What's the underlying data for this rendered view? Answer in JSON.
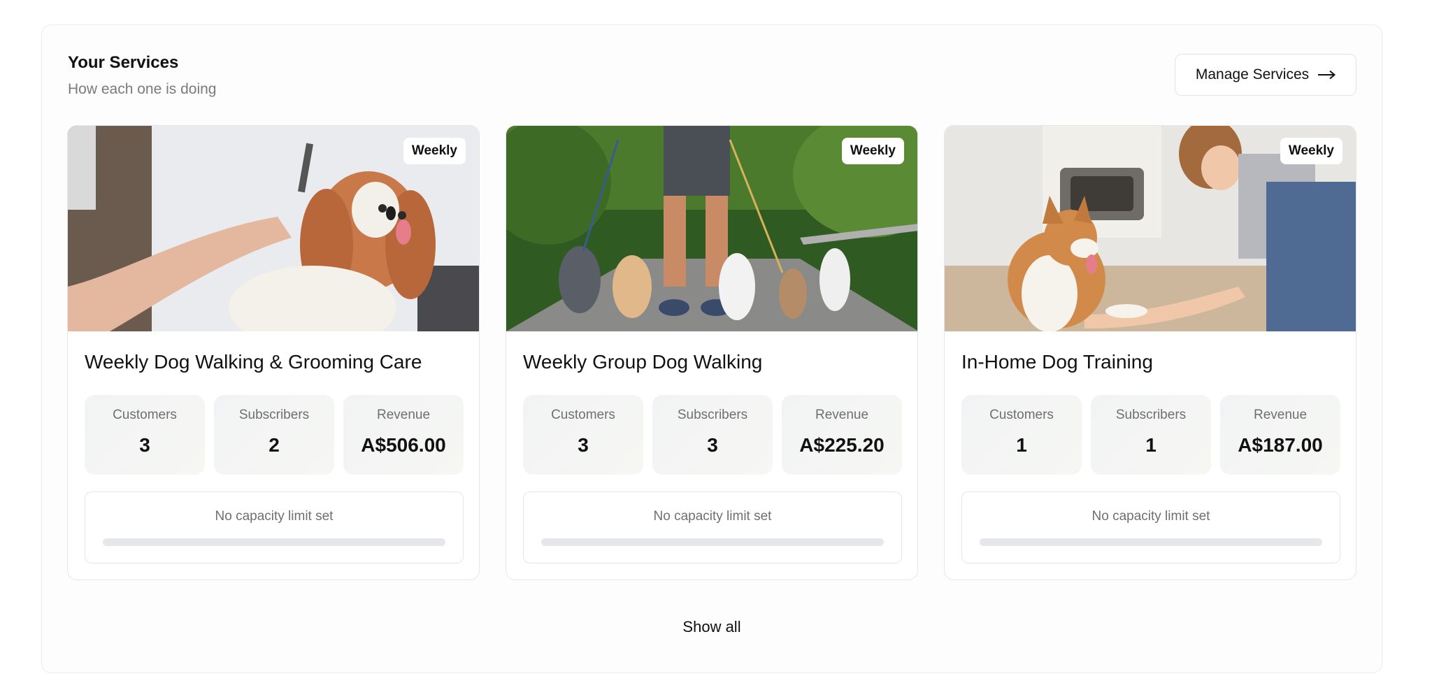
{
  "header": {
    "title": "Your Services",
    "subtitle": "How each one is doing",
    "manage_label": "Manage Services"
  },
  "services": [
    {
      "title": "Weekly Dog Walking & Grooming Care",
      "badge": "Weekly",
      "stats": [
        {
          "label": "Customers",
          "value": "3"
        },
        {
          "label": "Subscribers",
          "value": "2"
        },
        {
          "label": "Revenue",
          "value": "A$506.00"
        }
      ],
      "capacity_text": "No capacity limit set",
      "capacity_fraction": 0
    },
    {
      "title": "Weekly Group Dog Walking",
      "badge": "Weekly",
      "stats": [
        {
          "label": "Customers",
          "value": "3"
        },
        {
          "label": "Subscribers",
          "value": "3"
        },
        {
          "label": "Revenue",
          "value": "A$225.20"
        }
      ],
      "capacity_text": "No capacity limit set",
      "capacity_fraction": 0
    },
    {
      "title": "In-Home Dog Training",
      "badge": "Weekly",
      "stats": [
        {
          "label": "Customers",
          "value": "1"
        },
        {
          "label": "Subscribers",
          "value": "1"
        },
        {
          "label": "Revenue",
          "value": "A$187.00"
        }
      ],
      "capacity_text": "No capacity limit set",
      "capacity_fraction": 0
    }
  ],
  "footer": {
    "show_all_label": "Show all"
  },
  "icons": {
    "manage": "arrow-right-icon"
  },
  "colors": {
    "accent": "#111111",
    "muted_text": "#7a7a7a",
    "bar_track": "#e6e7ea"
  }
}
